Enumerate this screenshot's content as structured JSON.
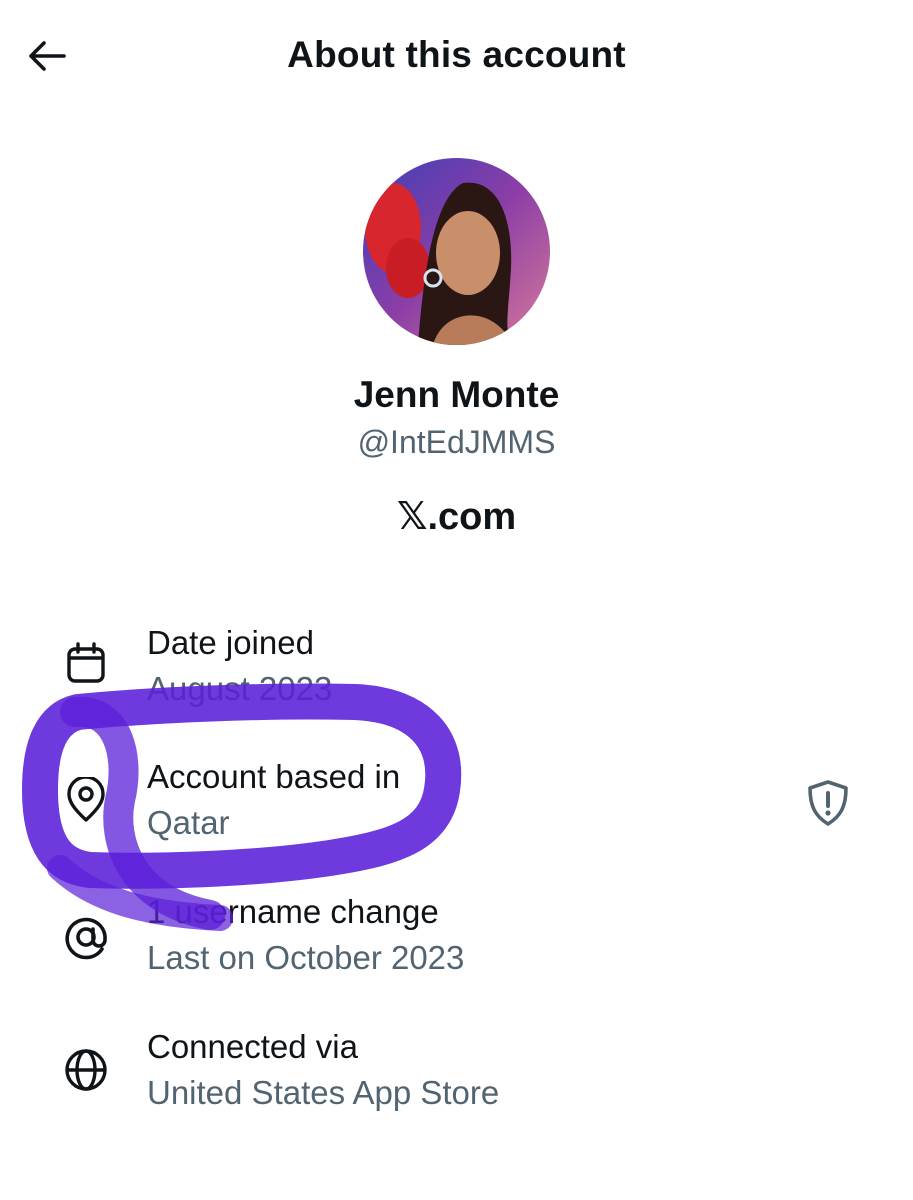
{
  "header": {
    "title": "About this account",
    "back_icon": "arrow-left-icon"
  },
  "profile": {
    "name": "Jenn Monte",
    "handle": "@IntEdJMMS",
    "platform": "𝕏.com"
  },
  "details": [
    {
      "icon": "calendar-icon",
      "label": "Date joined",
      "value": "August 2023"
    },
    {
      "icon": "location-pin-icon",
      "label": "Account based in",
      "value": "Qatar",
      "badge_icon": "shield-alert-icon"
    },
    {
      "icon": "at-sign-icon",
      "label": "1 username change",
      "value": "Last on October 2023"
    },
    {
      "icon": "globe-icon",
      "label": "Connected via",
      "value": "United States App Store"
    }
  ],
  "colors": {
    "text": "#0f1419",
    "secondary_text": "#536471",
    "highlight_marker": "#5b1fd8"
  }
}
